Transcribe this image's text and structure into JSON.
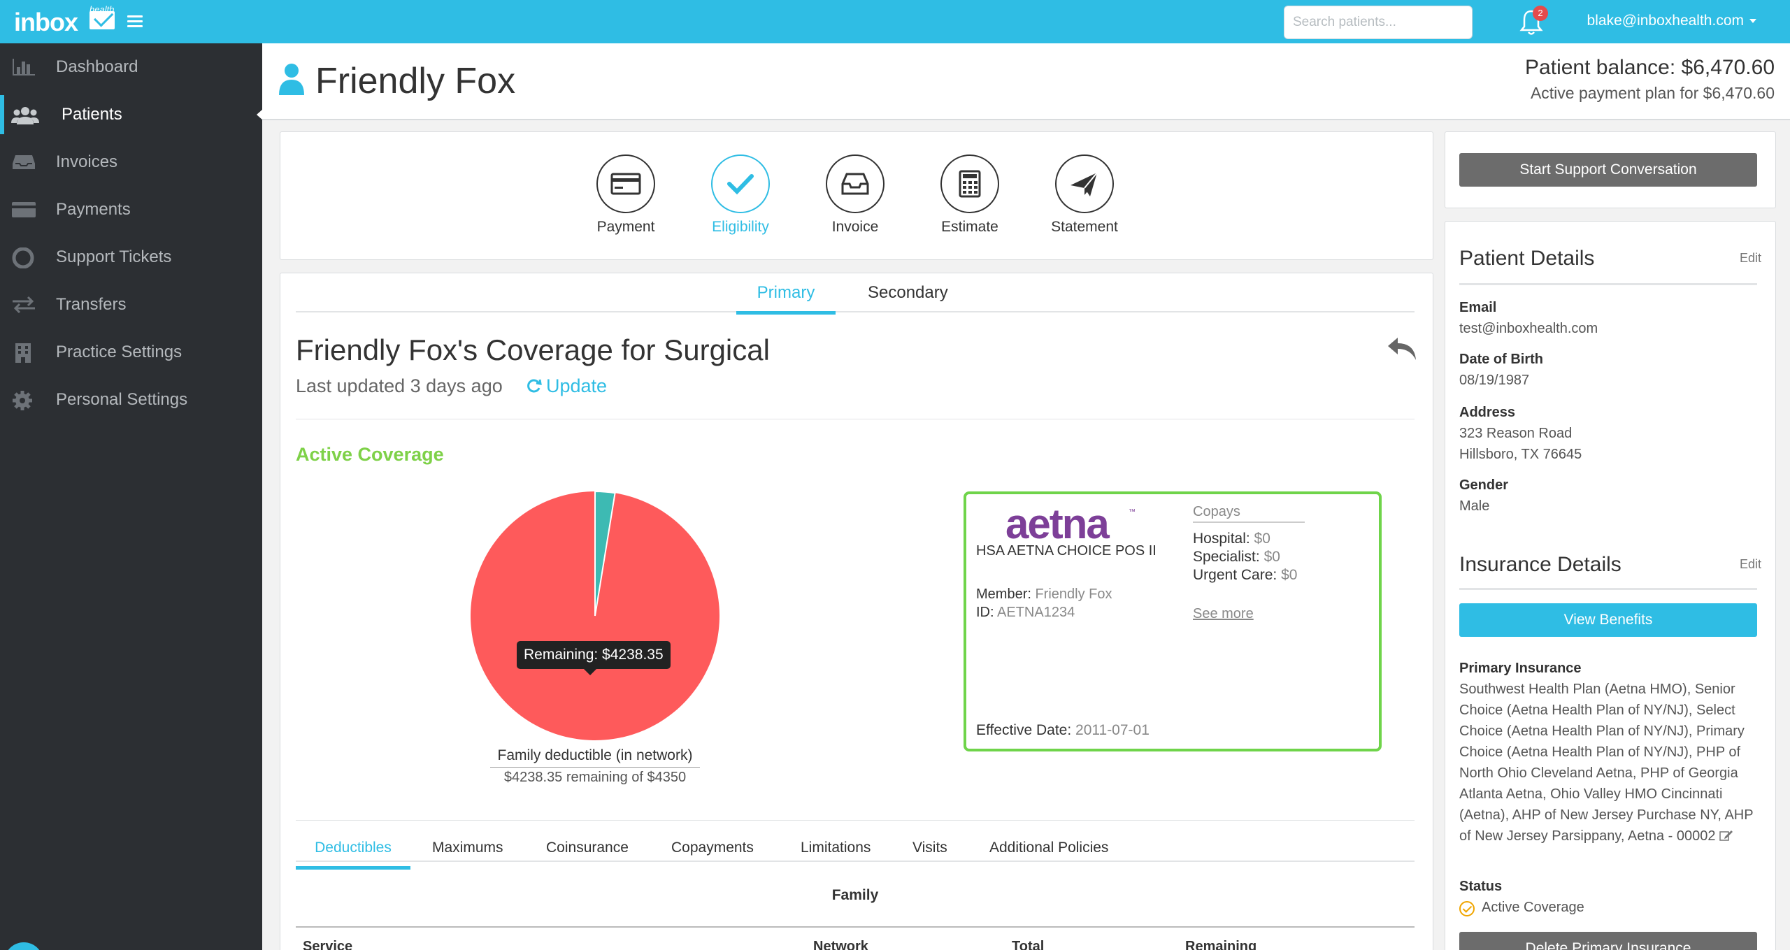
{
  "app": {
    "logo_text": "inbox",
    "logo_sub": "health"
  },
  "topbar": {
    "search_placeholder": "Search patients...",
    "notification_count": "2",
    "user_email": "blake@inboxhealth.com"
  },
  "sidebar": {
    "items": [
      {
        "label": "Dashboard",
        "icon": "bar-chart-icon"
      },
      {
        "label": "Patients",
        "icon": "users-icon"
      },
      {
        "label": "Invoices",
        "icon": "inbox-tray-icon"
      },
      {
        "label": "Payments",
        "icon": "credit-card-icon"
      },
      {
        "label": "Support Tickets",
        "icon": "life-ring-icon"
      },
      {
        "label": "Transfers",
        "icon": "exchange-icon"
      },
      {
        "label": "Practice Settings",
        "icon": "building-icon"
      },
      {
        "label": "Personal Settings",
        "icon": "gear-icon"
      }
    ],
    "help_label": "?"
  },
  "header": {
    "patient_name": "Friendly Fox",
    "balance": "Patient balance: $6,470.60",
    "plan": "Active payment plan for $6,470.60"
  },
  "actions": [
    {
      "label": "Payment",
      "icon": "credit-card-icon"
    },
    {
      "label": "Eligibility",
      "icon": "check-icon"
    },
    {
      "label": "Invoice",
      "icon": "inbox-tray-icon"
    },
    {
      "label": "Estimate",
      "icon": "calculator-icon"
    },
    {
      "label": "Statement",
      "icon": "paper-plane-icon"
    }
  ],
  "coverage": {
    "tabs": [
      "Primary",
      "Secondary"
    ],
    "title": "Friendly Fox's Coverage for Surgical",
    "last_updated": "Last updated 3 days ago",
    "update_label": "Update",
    "active_label": "Active Coverage",
    "tooltip": "Remaining: $4238.35",
    "pie_label": "Family deductible (in network)",
    "pie_sub": "$4238.35 remaining of $4350",
    "pie": {
      "remaining": 4238.35,
      "total": 4350,
      "remaining_color": "#fe5a5b",
      "used_color": "#3dbab3"
    }
  },
  "insurance_card": {
    "brand": "aetna",
    "brand_tm": "™",
    "plan_name": "HSA AETNA CHOICE POS II",
    "member_label": "Member:",
    "member_value": "Friendly Fox",
    "id_label": "ID:",
    "id_value": "AETNA1234",
    "copays_title": "Copays",
    "copays": [
      {
        "label": "Hospital:",
        "value": "$0"
      },
      {
        "label": "Specialist:",
        "value": "$0"
      },
      {
        "label": "Urgent Care:",
        "value": "$0"
      }
    ],
    "see_more": "See more",
    "effective_label": "Effective Date:",
    "effective_value": "2011-07-01"
  },
  "benefit_tabs": [
    "Deductibles",
    "Maximums",
    "Coinsurance",
    "Copayments",
    "Limitations",
    "Visits",
    "Additional Policies"
  ],
  "table": {
    "group": "Family",
    "headers": [
      "Service",
      "Network",
      "Total",
      "Remaining"
    ]
  },
  "right": {
    "support_btn": "Start Support Conversation",
    "patient_details_title": "Patient Details",
    "edit_label": "Edit",
    "email_label": "Email",
    "email": "test@inboxhealth.com",
    "dob_label": "Date of Birth",
    "dob": "08/19/1987",
    "address_label": "Address",
    "address_1": "323 Reason Road",
    "address_2": "Hillsboro, TX 76645",
    "gender_label": "Gender",
    "gender": "Male",
    "insurance_title": "Insurance Details",
    "view_benefits": "View Benefits",
    "primary_label": "Primary Insurance",
    "primary_value": "Southwest Health Plan (Aetna HMO), Senior Choice (Aetna Health Plan of NY/NJ), Select Choice (Aetna Health Plan of NY/NJ), Primary Choice (Aetna Health Plan of NY/NJ), PHP of North Ohio Cleveland Aetna, PHP of Georgia Atlanta Aetna, Ohio Valley HMO Cincinnati (Aetna), AHP of New Jersey Purchase NY, AHP of New Jersey Parsippany, Aetna - 00002",
    "status_label": "Status",
    "status_value": "Active Coverage",
    "delete_btn": "Delete Primary Insurance"
  },
  "colors": {
    "brand": "#2fbde4",
    "sidebar": "#2c2f33",
    "active_green": "#7ed148"
  }
}
